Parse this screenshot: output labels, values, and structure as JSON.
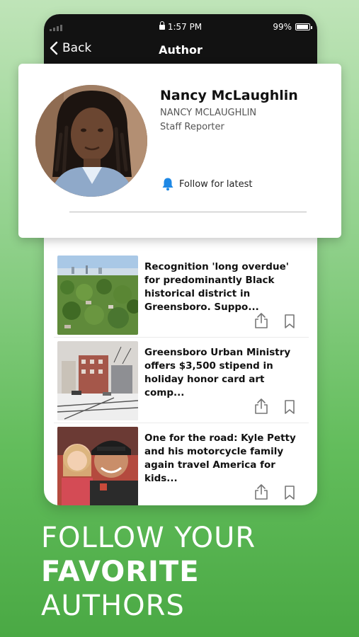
{
  "status_bar": {
    "time": "1:57 PM",
    "battery": "99%"
  },
  "nav": {
    "back_label": "Back",
    "title": "Author"
  },
  "author": {
    "name": "Nancy McLaughlin",
    "name_caps": "NANCY MCLAUGHLIN",
    "role": "Staff Reporter",
    "follow_label": "Follow for latest"
  },
  "articles": [
    {
      "headline": "Recognition 'long overdue' for predominantly Black historical district in Greensboro. Suppo...",
      "thumb_icon": "aerial-city-photo"
    },
    {
      "headline": "Greensboro Urban Ministry offers $3,500 stipend in holiday honor card art comp...",
      "thumb_icon": "snowy-street-painting"
    },
    {
      "headline": "One for the road: Kyle Petty and his motorcycle family again travel America for kids...",
      "thumb_icon": "family-photo"
    }
  ],
  "promo": {
    "line1": "FOLLOW YOUR",
    "line2": "FAVORITE",
    "line3": "AUTHORS"
  },
  "colors": {
    "accent": "#1e88e5",
    "background_green": "#63bd5c",
    "header_black": "#121212"
  }
}
